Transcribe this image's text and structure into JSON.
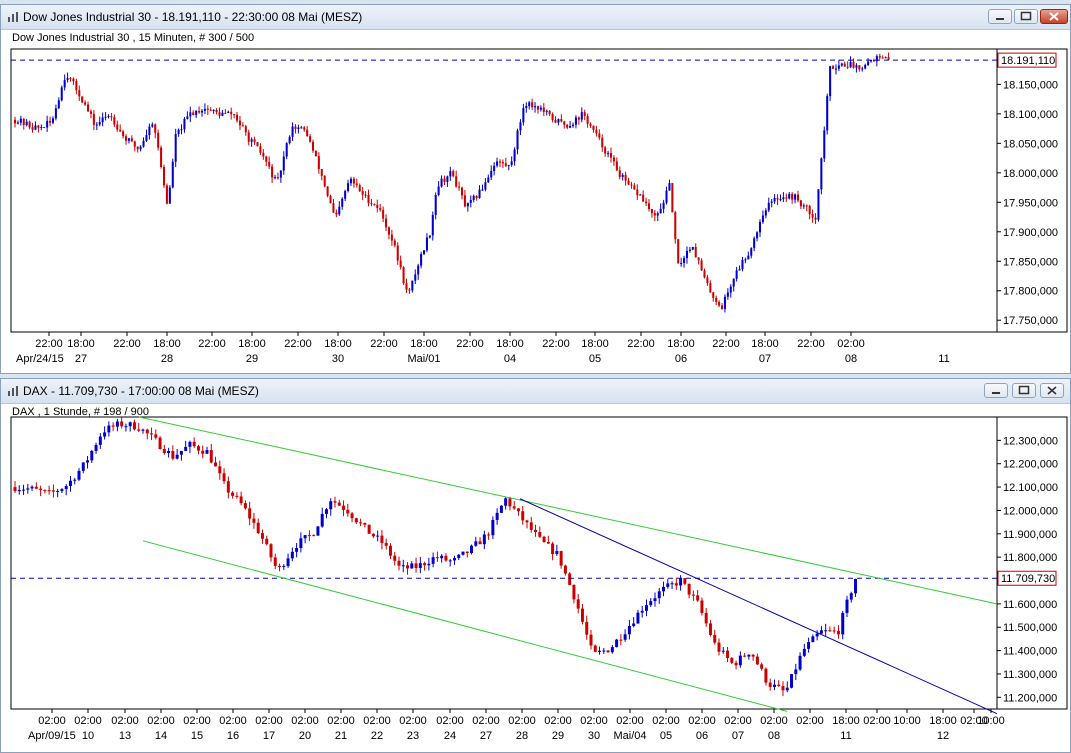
{
  "dow_window": {
    "title": "Dow Jones Industrial 30 - 18.191,110 - 22:30:00  08 Mai (MESZ)",
    "subtitle": "Dow Jones Industrial 30 , 15 Minuten, # 300 / 500"
  },
  "dax_window": {
    "title": "DAX - 11.709,730 - 17:00:00  08 Mai (MESZ)",
    "subtitle": "DAX , 1 Stunde, # 198 / 900"
  },
  "colors": {
    "up_candle": "#0000cc",
    "down_candle": "#cc0000",
    "channel_line": "#33cc33",
    "trend_line": "#0000aa",
    "current_price_line": "#0000cc"
  },
  "chart_data": [
    {
      "type": "candlestick",
      "instrument": "Dow Jones Industrial 30",
      "interval": "15 Minuten",
      "ylim": [
        17730000,
        18210000
      ],
      "y_ticks": [
        "17.750,000",
        "17.800,000",
        "17.850,000",
        "17.900,000",
        "17.950,000",
        "18.000,000",
        "18.050,000",
        "18.100,000",
        "18.150,000",
        "18.191,110"
      ],
      "y_tick_values": [
        17750000,
        17800000,
        17850000,
        17900000,
        17950000,
        18000000,
        18050000,
        18100000,
        18150000
      ],
      "current_price": 18191110,
      "current_price_label": "18.191,110",
      "x_time_labels": [
        "22:00",
        "18:00",
        "22:00",
        "18:00",
        "22:00",
        "18:00",
        "22:00",
        "18:00",
        "22:00",
        "18:00",
        "22:00",
        "18:00",
        "22:00",
        "18:00",
        "22:00",
        "18:00",
        "22:00",
        "18:00",
        "22:00",
        "02:00"
      ],
      "x_date_labels": [
        "Apr/24/15",
        "27",
        "28",
        "29",
        "30",
        "Mai/01",
        "04",
        "05",
        "06",
        "07",
        "08",
        "11"
      ],
      "close_path": [
        [
          0,
          18090
        ],
        [
          0.03,
          18075
        ],
        [
          0.05,
          18085
        ],
        [
          0.07,
          18170
        ],
        [
          0.09,
          18130
        ],
        [
          0.11,
          18080
        ],
        [
          0.13,
          18100
        ],
        [
          0.15,
          18060
        ],
        [
          0.17,
          18040
        ],
        [
          0.19,
          18090
        ],
        [
          0.21,
          17940
        ],
        [
          0.22,
          18060
        ],
        [
          0.24,
          18100
        ],
        [
          0.26,
          18110
        ],
        [
          0.28,
          18100
        ],
        [
          0.3,
          18100
        ],
        [
          0.32,
          18060
        ],
        [
          0.34,
          18030
        ],
        [
          0.36,
          17980
        ],
        [
          0.38,
          18080
        ],
        [
          0.4,
          18070
        ],
        [
          0.42,
          18000
        ],
        [
          0.44,
          17920
        ],
        [
          0.46,
          17990
        ],
        [
          0.48,
          17960
        ],
        [
          0.5,
          17940
        ],
        [
          0.52,
          17880
        ],
        [
          0.54,
          17790
        ],
        [
          0.555,
          17850
        ],
        [
          0.57,
          17900
        ],
        [
          0.58,
          17980
        ],
        [
          0.6,
          18000
        ],
        [
          0.62,
          17940
        ],
        [
          0.64,
          17970
        ],
        [
          0.66,
          18020
        ],
        [
          0.68,
          18010
        ],
        [
          0.7,
          18120
        ],
        [
          0.72,
          18110
        ],
        [
          0.74,
          18090
        ],
        [
          0.76,
          18080
        ],
        [
          0.78,
          18100
        ],
        [
          0.8,
          18060
        ],
        [
          0.82,
          18020
        ],
        [
          0.84,
          17980
        ],
        [
          0.86,
          17960
        ],
        [
          0.88,
          17920
        ],
        [
          0.9,
          17980
        ],
        [
          0.91,
          17840
        ],
        [
          0.93,
          17880
        ],
        [
          0.95,
          17810
        ],
        [
          0.97,
          17770
        ],
        [
          0.99,
          17830
        ],
        [
          1.01,
          17870
        ],
        [
          1.03,
          17940
        ],
        [
          1.05,
          17960
        ],
        [
          1.07,
          17960
        ],
        [
          1.09,
          17935
        ],
        [
          1.1,
          17925
        ],
        [
          1.12,
          18180
        ],
        [
          1.14,
          18185
        ],
        [
          1.16,
          18180
        ],
        [
          1.18,
          18195
        ],
        [
          1.2,
          18191
        ]
      ]
    },
    {
      "type": "candlestick",
      "instrument": "DAX",
      "interval": "1 Stunde",
      "ylim": [
        11150000,
        12400000
      ],
      "y_ticks": [
        "11.200,000",
        "11.300,000",
        "11.400,000",
        "11.500,000",
        "11.600,000",
        "11.709,730",
        "11.800,000",
        "11.900,000",
        "12.000,000",
        "12.100,000",
        "12.200,000",
        "12.300,000"
      ],
      "y_tick_values": [
        11200000,
        11300000,
        11400000,
        11500000,
        11600000,
        11800000,
        11900000,
        12000000,
        12100000,
        12200000,
        12300000
      ],
      "current_price": 11709730,
      "current_price_label": "11.709,730",
      "x_time_labels": [
        "02:00",
        "02:00",
        "02:00",
        "02:00",
        "02:00",
        "02:00",
        "02:00",
        "02:00",
        "02:00",
        "02:00",
        "02:00",
        "02:00",
        "02:00",
        "02:00",
        "02:00",
        "02:00",
        "02:00",
        "02:00",
        "02:00",
        "02:00",
        "02:00",
        "02:00",
        "18:00",
        "02:00",
        "10:00",
        "18:00",
        "02:00",
        "10:00"
      ],
      "x_date_labels": [
        "Apr/09/15",
        "10",
        "13",
        "14",
        "15",
        "16",
        "17",
        "20",
        "21",
        "22",
        "23",
        "24",
        "27",
        "28",
        "29",
        "30",
        "Mai/04",
        "05",
        "06",
        "07",
        "08",
        "11",
        "12"
      ],
      "close_path": [
        [
          0,
          12100
        ],
        [
          0.02,
          12090
        ],
        [
          0.04,
          12070
        ],
        [
          0.06,
          12110
        ],
        [
          0.08,
          12200
        ],
        [
          0.1,
          12340
        ],
        [
          0.12,
          12370
        ],
        [
          0.14,
          12360
        ],
        [
          0.16,
          12300
        ],
        [
          0.18,
          12230
        ],
        [
          0.2,
          12280
        ],
        [
          0.22,
          12250
        ],
        [
          0.24,
          12100
        ],
        [
          0.26,
          12020
        ],
        [
          0.28,
          11900
        ],
        [
          0.3,
          11740
        ],
        [
          0.32,
          11850
        ],
        [
          0.34,
          11900
        ],
        [
          0.36,
          12050
        ],
        [
          0.38,
          12000
        ],
        [
          0.4,
          11920
        ],
        [
          0.42,
          11860
        ],
        [
          0.44,
          11750
        ],
        [
          0.46,
          11760
        ],
        [
          0.48,
          11800
        ],
        [
          0.5,
          11780
        ],
        [
          0.52,
          11830
        ],
        [
          0.54,
          11900
        ],
        [
          0.56,
          12050
        ],
        [
          0.58,
          11960
        ],
        [
          0.6,
          11870
        ],
        [
          0.62,
          11810
        ],
        [
          0.64,
          11620
        ],
        [
          0.66,
          11380
        ],
        [
          0.68,
          11410
        ],
        [
          0.7,
          11500
        ],
        [
          0.72,
          11600
        ],
        [
          0.74,
          11660
        ],
        [
          0.76,
          11700
        ],
        [
          0.78,
          11600
        ],
        [
          0.8,
          11420
        ],
        [
          0.82,
          11340
        ],
        [
          0.84,
          11400
        ],
        [
          0.86,
          11260
        ],
        [
          0.88,
          11220
        ],
        [
          0.9,
          11400
        ],
        [
          0.92,
          11480
        ],
        [
          0.94,
          11480
        ],
        [
          0.95,
          11600
        ],
        [
          0.96,
          11709
        ]
      ],
      "lines": [
        {
          "name": "upper channel",
          "from": [
            "2015-04-13",
            12400
          ],
          "to": [
            "2015-05-12",
            11600
          ]
        },
        {
          "name": "lower channel",
          "from": [
            "2015-04-13",
            11870
          ],
          "to": [
            "2015-05-08",
            11140
          ]
        },
        {
          "name": "trend line",
          "from": [
            "2015-04-28",
            12050
          ],
          "to": [
            "2015-05-12",
            11130
          ]
        }
      ]
    }
  ]
}
